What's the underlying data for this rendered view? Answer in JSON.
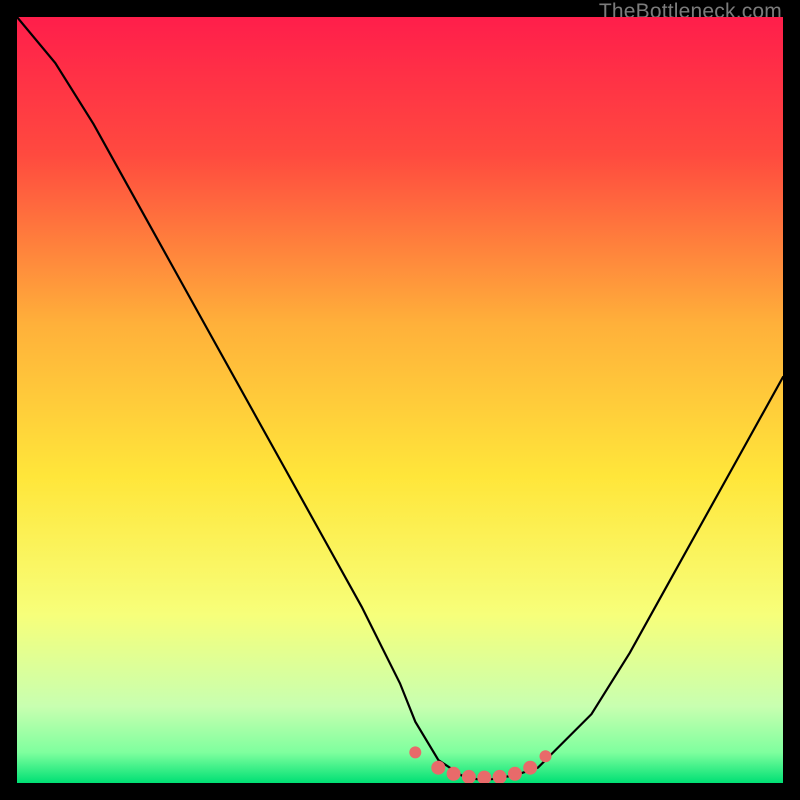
{
  "attribution": "TheBottleneck.com",
  "colors": {
    "bg_top": "#ff1e4b",
    "bg_mid1": "#ff7a3a",
    "bg_mid2": "#ffd63a",
    "bg_mid3": "#faff7a",
    "bg_low": "#d9ffb0",
    "bg_bottom": "#00e074",
    "curve": "#000000",
    "dots": "#e86a6a",
    "frame": "#000000"
  },
  "chart_data": {
    "type": "line",
    "title": "",
    "xlabel": "",
    "ylabel": "",
    "xlim": [
      0,
      100
    ],
    "ylim": [
      0,
      100
    ],
    "series": [
      {
        "name": "bottleneck-curve",
        "x": [
          0,
          5,
          10,
          15,
          20,
          25,
          30,
          35,
          40,
          45,
          50,
          52,
          55,
          58,
          60,
          62,
          65,
          68,
          70,
          75,
          80,
          85,
          90,
          95,
          100
        ],
        "y": [
          100,
          94,
          86,
          77,
          68,
          59,
          50,
          41,
          32,
          23,
          13,
          8,
          3,
          1,
          0.5,
          0.5,
          1,
          2,
          4,
          9,
          17,
          26,
          35,
          44,
          53
        ]
      }
    ],
    "marker_points": {
      "name": "flat-region-dots",
      "x": [
        52,
        55,
        57,
        59,
        61,
        63,
        65,
        67,
        69
      ],
      "y": [
        4,
        2,
        1.2,
        0.8,
        0.7,
        0.8,
        1.2,
        2,
        3.5
      ]
    },
    "gradient_stops": [
      {
        "offset": 0.0,
        "color": "#ff1e4b"
      },
      {
        "offset": 0.18,
        "color": "#ff4a3f"
      },
      {
        "offset": 0.4,
        "color": "#ffb03a"
      },
      {
        "offset": 0.6,
        "color": "#ffe63a"
      },
      {
        "offset": 0.78,
        "color": "#f7ff7a"
      },
      {
        "offset": 0.9,
        "color": "#c8ffb0"
      },
      {
        "offset": 0.96,
        "color": "#7fff9e"
      },
      {
        "offset": 1.0,
        "color": "#00e074"
      }
    ]
  }
}
